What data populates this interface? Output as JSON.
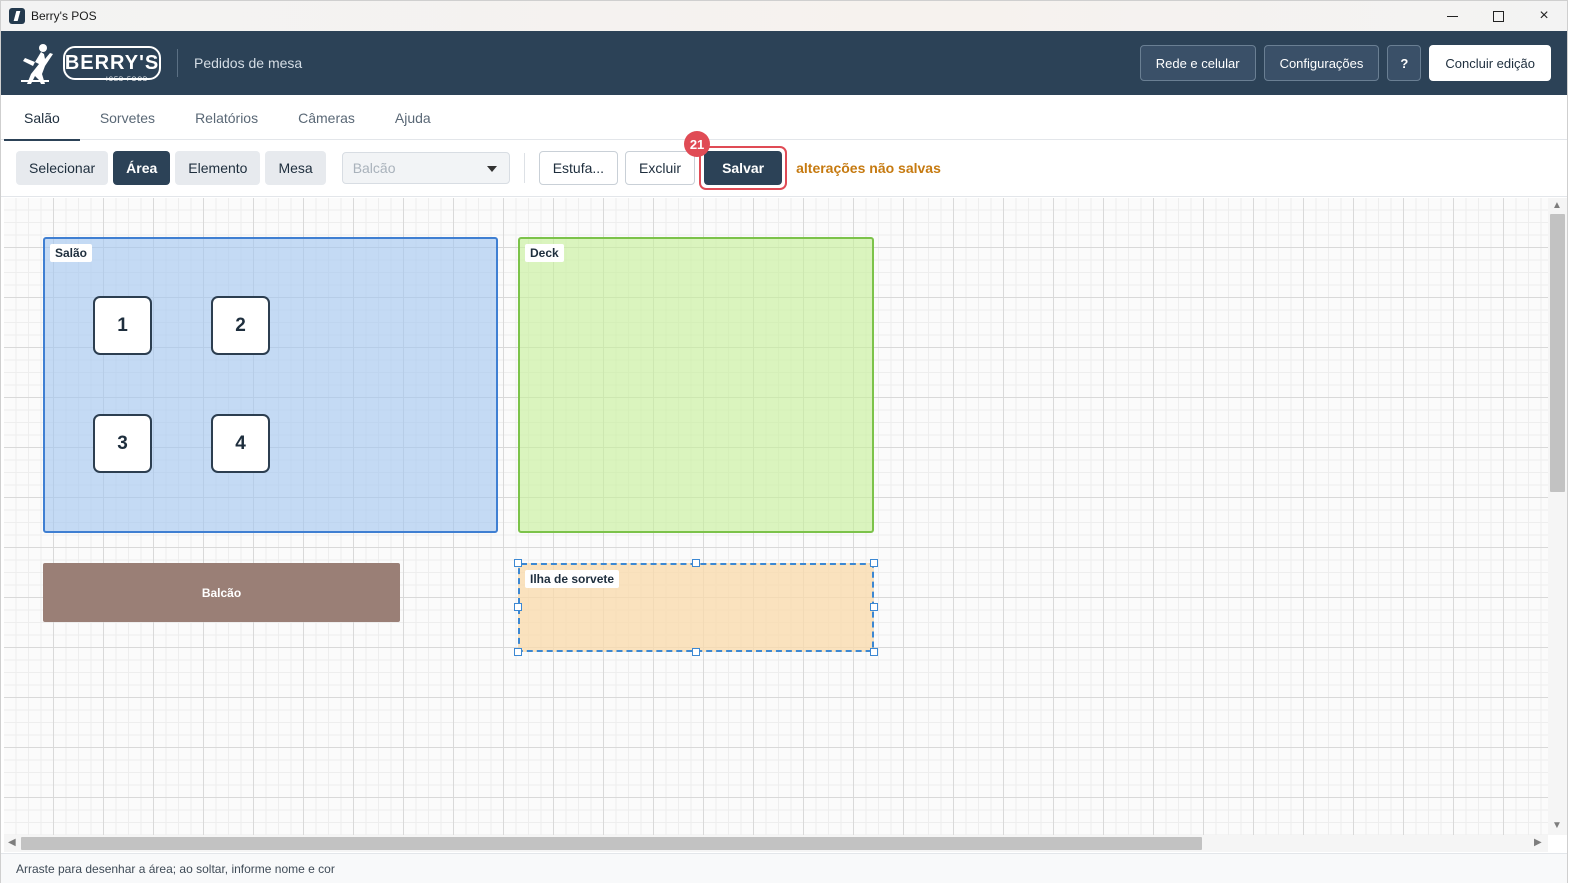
{
  "window": {
    "title": "Berry's POS",
    "controls": {
      "minimize": "minimize-icon",
      "maximize": "maximize-icon",
      "close": "×"
    }
  },
  "header": {
    "brand": "BERRY'S",
    "brand_sub": "ICED FOOD",
    "subtitle": "Pedidos de mesa",
    "actions": {
      "network": "Rede e celular",
      "settings": "Configurações",
      "help": "?",
      "finish": "Concluir edição"
    }
  },
  "tabs": [
    {
      "label": "Salão",
      "active": true
    },
    {
      "label": "Sorvetes",
      "active": false
    },
    {
      "label": "Relatórios",
      "active": false
    },
    {
      "label": "Câmeras",
      "active": false
    },
    {
      "label": "Ajuda",
      "active": false
    }
  ],
  "toolbar": {
    "tools": [
      {
        "label": "Selecionar",
        "active": false
      },
      {
        "label": "Área",
        "active": true
      },
      {
        "label": "Elemento",
        "active": false
      },
      {
        "label": "Mesa",
        "active": false
      }
    ],
    "select_value": "Balcão",
    "estufa": "Estufa...",
    "delete": "Excluir",
    "save": "Salvar",
    "badge": "21",
    "unsaved": "alterações não salvas"
  },
  "canvas": {
    "areas": {
      "salao": "Salão",
      "deck": "Deck",
      "ilha": "Ilha de sorvete"
    },
    "tables": [
      "1",
      "2",
      "3",
      "4"
    ],
    "counter": "Balcão"
  },
  "colors": {
    "header_bg": "#2c4257",
    "accent_red": "#e04b55",
    "unsaved_text": "#c67a10",
    "salao_fill": "#a0c4f0",
    "deck_fill": "#c4f096",
    "ilha_fill": "#fadaaa",
    "counter_fill": "#9a7f76"
  },
  "status": {
    "hint": "Arraste para desenhar a área; ao soltar, informe nome e cor"
  }
}
